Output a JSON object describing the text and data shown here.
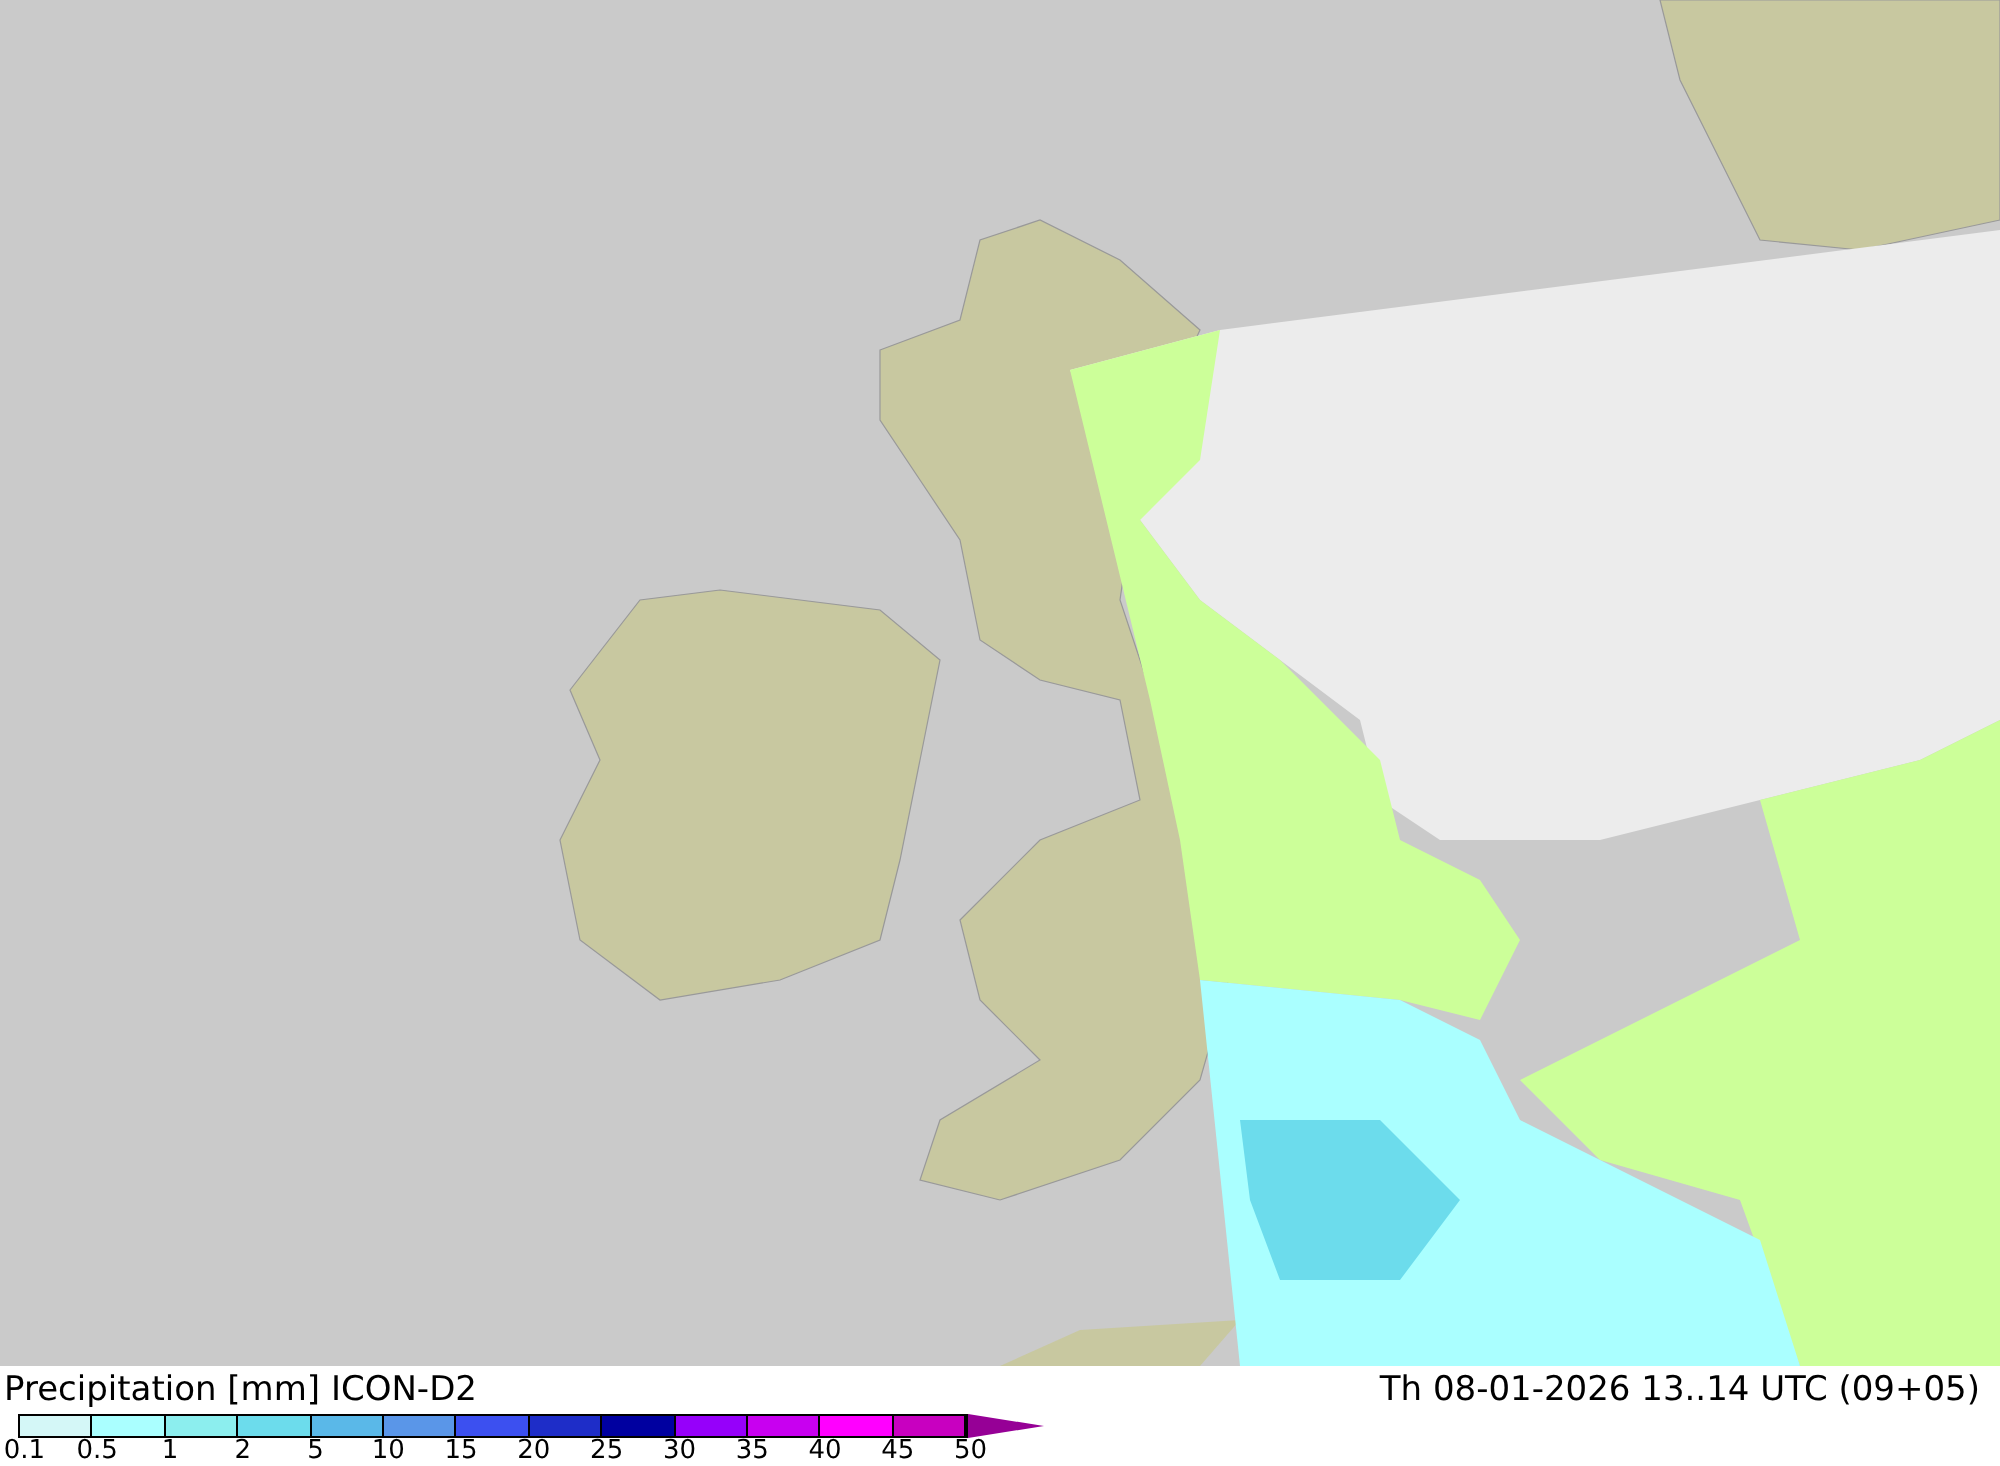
{
  "legend": {
    "title": "Precipitation [mm] ICON-D2",
    "valid_time": "Th 08-01-2026 13..14 UTC (09+05)",
    "segments": [
      {
        "color": "#d4f7f7"
      },
      {
        "color": "#aaffff"
      },
      {
        "color": "#8ceeee"
      },
      {
        "color": "#6cdcec"
      },
      {
        "color": "#5ab8e8"
      },
      {
        "color": "#5a96e8"
      },
      {
        "color": "#3c50f0"
      },
      {
        "color": "#1e2dc8"
      },
      {
        "color": "#0000a0"
      },
      {
        "color": "#9600fa"
      },
      {
        "color": "#c800f0"
      },
      {
        "color": "#ff00ff"
      },
      {
        "color": "#c800c0"
      }
    ],
    "overflow_arrow": {
      "color": "#960096"
    },
    "labels": [
      "0.1",
      "0.5",
      "1",
      "2",
      "5",
      "10",
      "15",
      "20",
      "25",
      "30",
      "35",
      "40",
      "45",
      "50"
    ]
  }
}
